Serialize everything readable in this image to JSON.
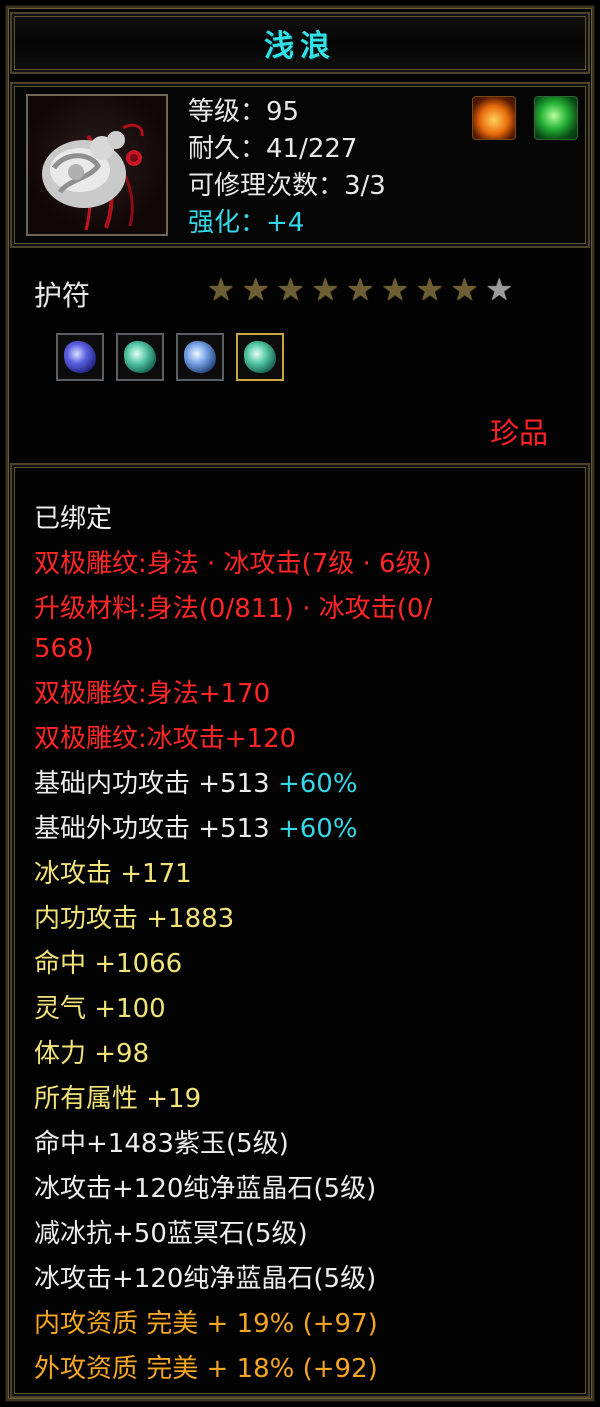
{
  "item": {
    "name": "浅浪",
    "level": "等级：95",
    "durability": "耐久：41/227",
    "repairs": "可修理次数：3/3",
    "enhance": "强化：+4"
  },
  "category": "护符",
  "stars": {
    "filled": 8,
    "total": 9
  },
  "gems": [
    {
      "name": "purple-gem-icon",
      "color": "#5b62e0"
    },
    {
      "name": "teal-gem-icon",
      "color": "#57c9a6"
    },
    {
      "name": "blue-gem-icon",
      "color": "#7aa6e8"
    },
    {
      "name": "teal-gem-icon",
      "color": "#57c9a6",
      "selected": true
    }
  ],
  "rarity": "珍品",
  "properties": {
    "bound": "已绑定",
    "engrave_header": "双极雕纹:身法 · 冰攻击(7级 · 6级)",
    "upgrade_line1": "升级材料:身法(0/811) · 冰攻击(0/",
    "upgrade_line2": "568)",
    "engrave_a": "双极雕纹:身法+170",
    "engrave_b": "双极雕纹:冰攻击+120",
    "base_inner": "基础内功攻击  +513",
    "base_inner_pct": "+60%",
    "base_outer": "基础外功攻击  +513",
    "base_outer_pct": "+60%",
    "stat1": "冰攻击  +171",
    "stat2": "内功攻击  +1883",
    "stat3": "命中  +1066",
    "stat4": "灵气  +100",
    "stat5": "体力  +98",
    "stat6": "所有属性  +19",
    "socket1": "命中+1483紫玉(5级)",
    "socket2": "冰攻击+120纯净蓝晶石(5级)",
    "socket3": "减冰抗+50蓝冥石(5级)",
    "socket4": "冰攻击+120纯净蓝晶石(5级)",
    "quality1": "内攻资质  完美  + 19% (+97)",
    "quality2": "外攻资质  完美  + 18% (+92)"
  },
  "colors": {
    "title": "#33e0e6",
    "red": "#ff2626",
    "yellow": "#f1e27a",
    "orange": "#f3a623",
    "cyan": "#33d7e6"
  }
}
